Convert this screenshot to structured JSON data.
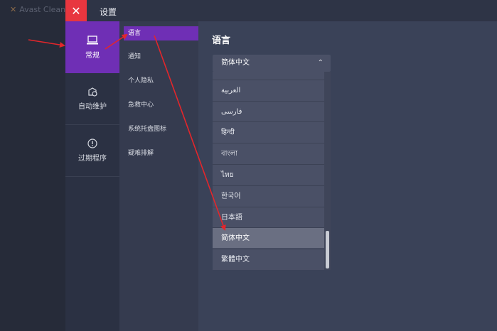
{
  "backdrop": {
    "app_name": "Avast Clean"
  },
  "window": {
    "title": "设置",
    "close_symbol": "✕"
  },
  "categories": [
    {
      "label": "常规",
      "icon": "laptop-icon",
      "active": true
    },
    {
      "label": "自动维护",
      "icon": "maintenance-icon",
      "active": false
    },
    {
      "label": "过期程序",
      "icon": "alert-icon",
      "active": false
    }
  ],
  "subnav": [
    {
      "label": "语言",
      "active": true
    },
    {
      "label": "通知",
      "active": false
    },
    {
      "label": "个人隐私",
      "active": false
    },
    {
      "label": "急救中心",
      "active": false
    },
    {
      "label": "系统托盘图标",
      "active": false
    },
    {
      "label": "疑难排解",
      "active": false
    }
  ],
  "language": {
    "section_title": "语言",
    "selected": "简体中文",
    "chevron": "⌃",
    "options": [
      "العربية",
      "فارسی",
      "हिन्दी",
      "বাংলা",
      "ไทย",
      "한국어",
      "日本語",
      "简体中文",
      "繁體中文"
    ],
    "selected_index": 7
  },
  "colors": {
    "accent": "#6f2fb5",
    "close": "#e8363f",
    "annotation_arrow": "#e3262b"
  }
}
